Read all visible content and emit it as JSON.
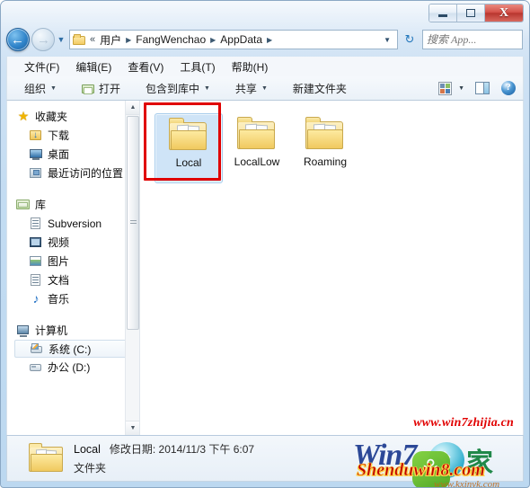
{
  "window": {
    "caption_buttons": {
      "minimize": "minimize-button",
      "maximize": "maximize-button",
      "close_label": "X"
    }
  },
  "address_bar": {
    "back_arrow": "←",
    "forward_arrow": "→",
    "recent_caret": "▼",
    "double_chevron": "«",
    "crumbs": [
      "用户",
      "FangWenchao",
      "AppData"
    ],
    "separator": "▶",
    "dropdown_caret": "▼",
    "refresh_glyph": "↻",
    "search": {
      "placeholder": "搜索 App...",
      "value": "",
      "icon": "search-icon"
    }
  },
  "menubar": {
    "items": [
      "文件(F)",
      "编辑(E)",
      "查看(V)",
      "工具(T)",
      "帮助(H)"
    ]
  },
  "toolbar": {
    "organize": "组织",
    "open": "打开",
    "include_in_library": "包含到库中",
    "share": "共享",
    "new_folder": "新建文件夹",
    "caret": "▼",
    "view_icon": "view-layout-icon",
    "preview_icon": "preview-pane-icon",
    "help_icon": "?"
  },
  "navpane": {
    "groups": [
      {
        "header": {
          "label": "收藏夹",
          "icon": "star-icon"
        },
        "items": [
          {
            "label": "下载",
            "icon": "download-folder-icon",
            "selected": false
          },
          {
            "label": "桌面",
            "icon": "desktop-icon",
            "selected": false
          },
          {
            "label": "最近访问的位置",
            "icon": "recent-places-icon",
            "selected": false
          }
        ]
      },
      {
        "header": {
          "label": "库",
          "icon": "library-icon"
        },
        "items": [
          {
            "label": "Subversion",
            "icon": "document-icon",
            "selected": false
          },
          {
            "label": "视频",
            "icon": "video-icon",
            "selected": false
          },
          {
            "label": "图片",
            "icon": "picture-icon",
            "selected": false
          },
          {
            "label": "文档",
            "icon": "document-icon",
            "selected": false
          },
          {
            "label": "音乐",
            "icon": "music-icon",
            "selected": false
          }
        ]
      },
      {
        "header": {
          "label": "计算机",
          "icon": "computer-icon"
        },
        "items": [
          {
            "label": "系统 (C:)",
            "icon": "system-drive-icon",
            "selected": true
          },
          {
            "label": "办公 (D:)",
            "icon": "drive-icon",
            "selected": false
          }
        ]
      }
    ],
    "scrollbar": {
      "up_arrow": "▲",
      "down_arrow": "▼"
    }
  },
  "files": {
    "items": [
      {
        "name": "Local",
        "icon": "folder-icon",
        "selected": true,
        "annotated": true
      },
      {
        "name": "LocalLow",
        "icon": "folder-icon",
        "selected": false,
        "annotated": false
      },
      {
        "name": "Roaming",
        "icon": "folder-icon",
        "selected": false,
        "annotated": false
      }
    ]
  },
  "statusbar": {
    "name": "Local",
    "meta": "修改日期: 2014/11/3 下午 6:07",
    "type": "文件夹"
  },
  "watermarks": {
    "url_red": "www.win7zhijia.cn",
    "logo_win7": "Win7",
    "logo_cn": "家",
    "shenduwin8": "Shenduwin8.com",
    "kxinyk": "www.kxinyk.com"
  },
  "colors": {
    "accent": "#2f83c9",
    "close_red": "#b9362f",
    "annotation_red": "#e00000",
    "selection_blue": "#cfe4f7",
    "watermark_red": "#e10000"
  }
}
